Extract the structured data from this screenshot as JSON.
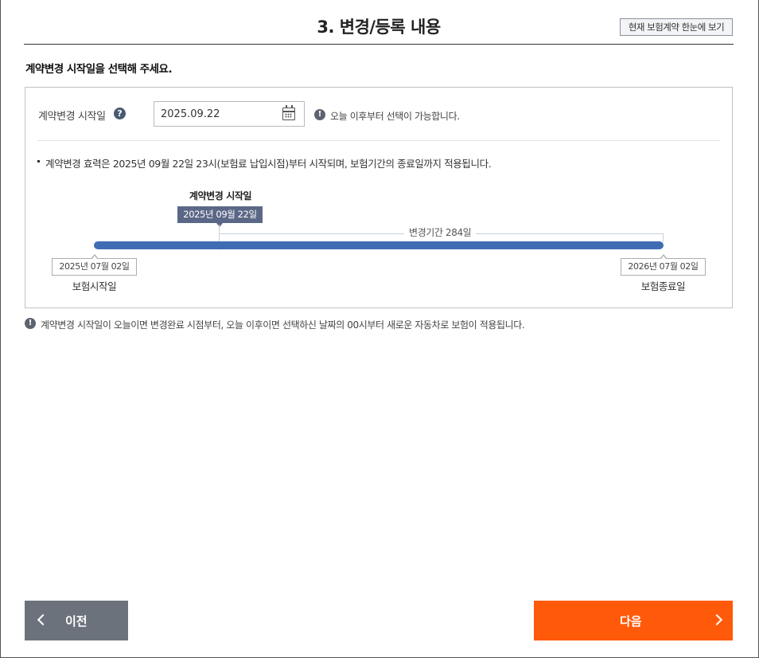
{
  "header": {
    "title": "3. 변경/등록 내용",
    "summary_button_label": "현재 보험계약 한눈에 보기"
  },
  "instruction": "계약변경 시작일을 선택해 주세요.",
  "form": {
    "start_date_label": "계약변경 시작일",
    "help_icon_glyph": "?",
    "start_date_value": "2025.09.22",
    "notice": "오늘 이후부터 선택이 가능합니다.",
    "info_icon_glyph": "!"
  },
  "effect_text": "계약변경 효력은 2025년 09월 22일 23시(보험료 납입시점)부터 시작되며, 보험기간의 종료일까지 적용됩니다.",
  "timeline": {
    "marker_title": "계약변경 시작일",
    "marker_date": "2025년 09월 22일",
    "period_label": "변경기간 284일",
    "start_date": "2025년 07월 02일",
    "start_label": "보험시작일",
    "end_date": "2026년 07월 02일",
    "end_label": "보험종료일",
    "bar_color": "#3f6db3"
  },
  "footer_note": "계약변경 시작일이 오늘이면 변경완료 시점부터, 오늘 이후이면 선택하신 날짜의 00시부터 새로운 자동차로 보험이 적용됩니다.",
  "nav": {
    "prev_label": "이전",
    "next_label": "다음",
    "next_color": "#ff5a0a",
    "prev_color": "#6c727b"
  }
}
